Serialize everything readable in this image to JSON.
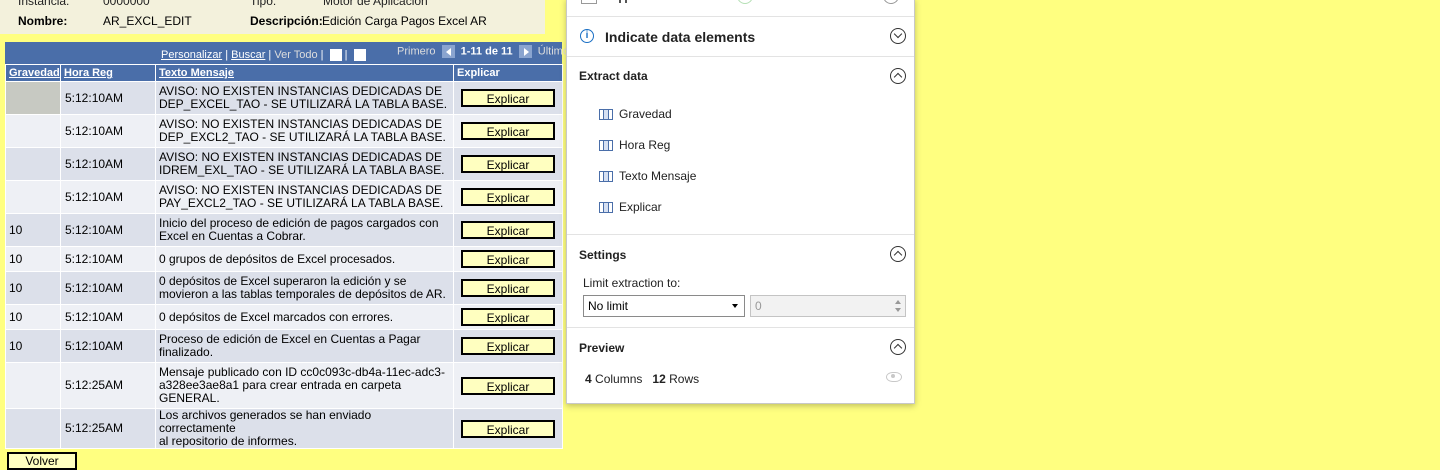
{
  "form": {
    "instancia_label": "Instancia:",
    "instancia_value": "0000000",
    "tipo_label": "Tipo:",
    "tipo_value": "Motor de Aplicación",
    "nombre_label": "Nombre:",
    "nombre_value": "AR_EXCL_EDIT",
    "descripcion_label": "Descripción:",
    "descripcion_value": "Edición Carga Pagos Excel AR"
  },
  "grid": {
    "personalizar": "Personalizar",
    "buscar": "Buscar",
    "ver_todo": "Ver Todo",
    "primero": "Primero",
    "range": "1-11 de 11",
    "ultimo": "Último",
    "columns": [
      "Gravedad",
      "Hora Reg",
      "Texto Mensaje",
      "Explicar"
    ],
    "explain_label": "Explicar",
    "rows": [
      {
        "sev": "",
        "time": "5:12:10AM",
        "msg1": "AVISO: NO EXISTEN INSTANCIAS DEDICADAS DE",
        "msg2": "DEP_EXCEL_TAO - SE UTILIZARÁ LA TABLA BASE.",
        "msg3": ""
      },
      {
        "sev": "",
        "time": "5:12:10AM",
        "msg1": "AVISO: NO EXISTEN INSTANCIAS DEDICADAS DE",
        "msg2": "DEP_EXCL2_TAO - SE UTILIZARÁ LA TABLA BASE.",
        "msg3": ""
      },
      {
        "sev": "",
        "time": "5:12:10AM",
        "msg1": "AVISO: NO EXISTEN INSTANCIAS DEDICADAS DE",
        "msg2": "IDREM_EXL_TAO - SE UTILIZARÁ LA TABLA BASE.",
        "msg3": ""
      },
      {
        "sev": "",
        "time": "5:12:10AM",
        "msg1": "AVISO: NO EXISTEN INSTANCIAS DEDICADAS DE",
        "msg2": "PAY_EXCL2_TAO - SE UTILIZARÁ LA TABLA BASE.",
        "msg3": ""
      },
      {
        "sev": "10",
        "time": "5:12:10AM",
        "msg1": "Inicio del proceso de edición de pagos cargados con",
        "msg2": "Excel en Cuentas a Cobrar.",
        "msg3": ""
      },
      {
        "sev": "10",
        "time": "5:12:10AM",
        "msg1": "0 grupos de depósitos de Excel procesados.",
        "msg2": "",
        "msg3": ""
      },
      {
        "sev": "10",
        "time": "5:12:10AM",
        "msg1": "0 depósitos de Excel superaron la edición y se",
        "msg2": "movieron a las tablas temporales de depósitos de AR.",
        "msg3": ""
      },
      {
        "sev": "10",
        "time": "5:12:10AM",
        "msg1": "0 depósitos de Excel marcados con errores.",
        "msg2": "",
        "msg3": ""
      },
      {
        "sev": "10",
        "time": "5:12:10AM",
        "msg1": "Proceso de edición de Excel en Cuentas a Pagar",
        "msg2": "finalizado.",
        "msg3": ""
      },
      {
        "sev": "",
        "time": "5:12:25AM",
        "msg1": "Mensaje publicado con ID cc0c093c-db4a-11ec-adc3-",
        "msg2": "a328ee3ae8a1 para crear entrada en carpeta",
        "msg3": "GENERAL."
      },
      {
        "sev": "",
        "time": "5:12:25AM",
        "msg1": "Los archivos generados se han enviado correctamente",
        "msg2": "al repositorio de informes.",
        "msg3": ""
      }
    ],
    "volver": "Volver"
  },
  "panel": {
    "indicate_title": "Indicate data elements",
    "extract_title": "Extract data",
    "fields": [
      "Gravedad",
      "Hora Reg",
      "Texto Mensaje",
      "Explicar"
    ],
    "settings_title": "Settings",
    "limit_label": "Limit extraction to:",
    "limit_select": "No limit",
    "limit_number": "0",
    "preview_title": "Preview",
    "columns_count": "4",
    "columns_word": "Columns",
    "rows_count": "12",
    "rows_word": "Rows"
  }
}
